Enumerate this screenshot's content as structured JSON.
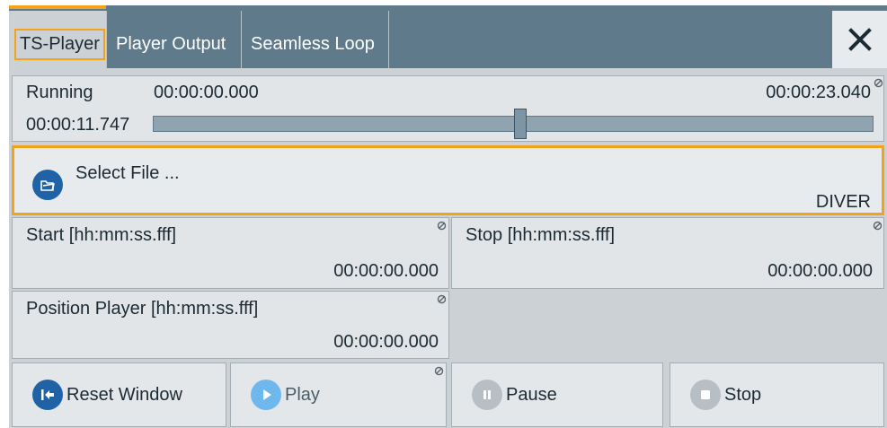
{
  "tabs": [
    {
      "label": "TS-Player",
      "active": true
    },
    {
      "label": "Player Output",
      "active": false
    },
    {
      "label": "Seamless Loop",
      "active": false
    }
  ],
  "close_icon": "close-icon",
  "status": {
    "state": "Running",
    "start_time": "00:00:00.000",
    "end_time": "00:00:23.040",
    "current_time": "00:00:11.747",
    "progress_fraction": 0.51
  },
  "file": {
    "label": "Select File ...",
    "value": "DIVER",
    "icon": "folder-open-icon"
  },
  "fields": {
    "start": {
      "label": "Start [hh:mm:ss.fff]",
      "value": "00:00:00.000"
    },
    "stop": {
      "label": "Stop [hh:mm:ss.fff]",
      "value": "00:00:00.000"
    },
    "position": {
      "label": "Position Player [hh:mm:ss.fff]",
      "value": "00:00:00.000"
    }
  },
  "buttons": {
    "reset": "Reset Window",
    "play": "Play",
    "pause": "Pause",
    "stop": "Stop"
  },
  "colors": {
    "accent": "#f5a21b",
    "tabbar": "#5f7a8b",
    "primary_blue": "#1f63a6",
    "play_blue": "#6fb8ee",
    "disabled_gray": "#b8bfc4"
  }
}
